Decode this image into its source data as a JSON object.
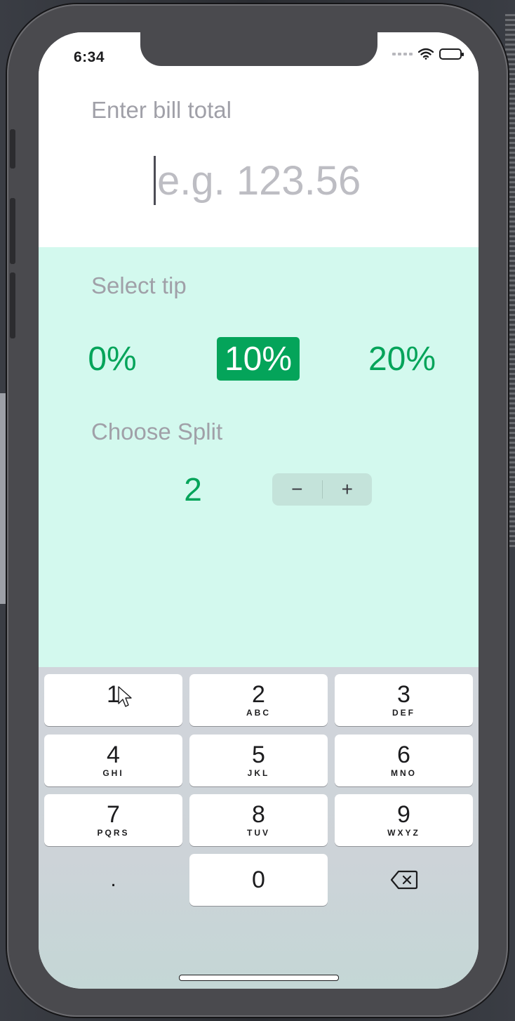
{
  "status_bar": {
    "time": "6:34"
  },
  "bill": {
    "label": "Enter bill total",
    "placeholder": "e.g. 123.56",
    "value": ""
  },
  "tip": {
    "label": "Select tip",
    "options": [
      "0%",
      "10%",
      "20%"
    ],
    "selected": "10%"
  },
  "split": {
    "label": "Choose Split",
    "value": "2",
    "decrement_label": "−",
    "increment_label": "+"
  },
  "keypad": {
    "keys": [
      {
        "digit": "1",
        "letters": ""
      },
      {
        "digit": "2",
        "letters": "ABC"
      },
      {
        "digit": "3",
        "letters": "DEF"
      },
      {
        "digit": "4",
        "letters": "GHI"
      },
      {
        "digit": "5",
        "letters": "JKL"
      },
      {
        "digit": "6",
        "letters": "MNO"
      },
      {
        "digit": "7",
        "letters": "PQRS"
      },
      {
        "digit": "8",
        "letters": "TUV"
      },
      {
        "digit": "9",
        "letters": "WXYZ"
      }
    ],
    "zero": "0",
    "decimal": ".",
    "delete_icon": "delete-backspace-icon"
  },
  "colors": {
    "accent_green": "#04a45a",
    "tip_background": "#d3f9ee",
    "label_gray": "#a0a0a8"
  }
}
